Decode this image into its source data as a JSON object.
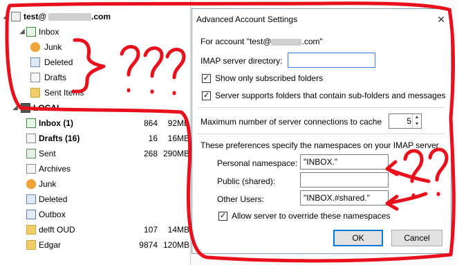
{
  "folders": {
    "account": {
      "label": "test@",
      "domain": ".com"
    },
    "inbox": "Inbox",
    "junk": "Junk",
    "deleted": "Deleted",
    "drafts": "Drafts",
    "sent_items": "Sent Items",
    "local": "LOCAL",
    "local_items": [
      {
        "label": "Inbox (1)",
        "count": "864",
        "size": "92MB",
        "bold": true
      },
      {
        "label": "Drafts (16)",
        "count": "16",
        "size": "16MB",
        "bold": true
      },
      {
        "label": "Sent",
        "count": "268",
        "size": "290MB"
      },
      {
        "label": "Archives",
        "count": "",
        "size": ""
      },
      {
        "label": "Junk",
        "count": "",
        "size": ""
      },
      {
        "label": "Deleted",
        "count": "",
        "size": ""
      },
      {
        "label": "Outbox",
        "count": "",
        "size": ""
      },
      {
        "label": "delft OUD",
        "count": "107",
        "size": "14MB"
      },
      {
        "label": "Edgar",
        "count": "9874",
        "size": "120MB"
      }
    ]
  },
  "dialog": {
    "title": "Advanced Account Settings",
    "close_glyph": "✕",
    "for_account": "For account \"test@",
    "for_account_end": ".com\"",
    "imap_dir_label": "IMAP server directory:",
    "imap_dir_value": "",
    "show_subscribed": "Show only subscribed folders",
    "sub_folders": "Server supports folders that contain sub-folders and messages",
    "max_conn_label": "Maximum number of server connections to cache",
    "max_conn_value": "5",
    "namespace_intro": "These preferences specify the namespaces on your IMAP server",
    "personal_label": "Personal namespace:",
    "personal_value": "\"INBOX.\"",
    "public_label": "Public (shared):",
    "public_value": "",
    "other_label": "Other Users:",
    "other_value": "\"INBOX.#shared.\"",
    "override": "Allow server to override these namespaces",
    "ok": "OK",
    "cancel": "Cancel"
  },
  "annotation_color": "#e8101c"
}
